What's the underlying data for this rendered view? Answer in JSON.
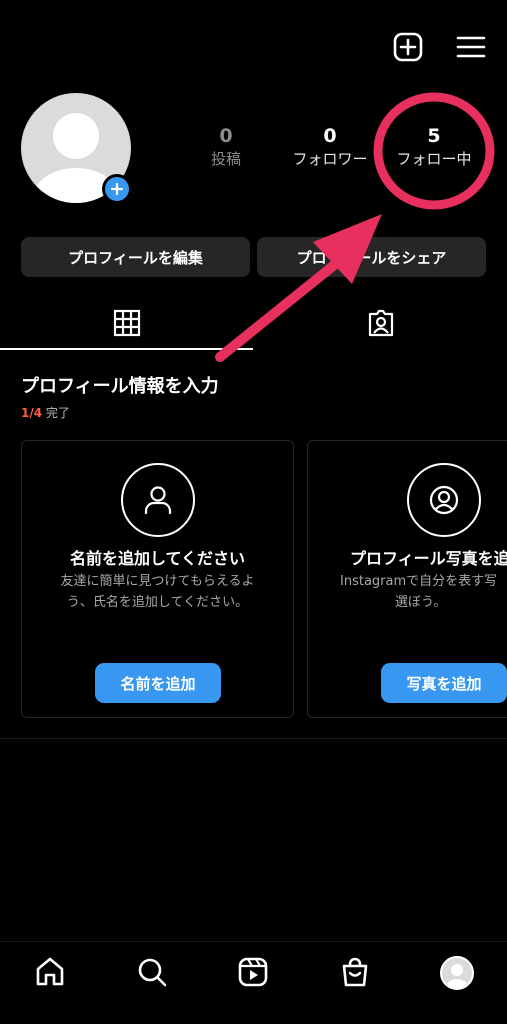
{
  "header": {
    "icons": [
      "plus-square-icon",
      "hamburger-menu-icon"
    ]
  },
  "stats": {
    "posts": {
      "count": "0",
      "label": "投稿"
    },
    "followers": {
      "count": "0",
      "label": "フォロワー"
    },
    "following": {
      "count": "5",
      "label": "フォロー中"
    }
  },
  "buttons": {
    "edit_profile": "プロフィールを編集",
    "share_profile": "プロフィールをシェア"
  },
  "tabs": {
    "grid": "grid-icon",
    "tagged": "tagged-person-icon"
  },
  "section": {
    "title": "プロフィール情報を入力",
    "progress_done": "1/4",
    "progress_label": " 完了"
  },
  "cards": [
    {
      "icon": "person-icon",
      "title": "名前を追加してください",
      "desc_line1": "友達に簡単に見つけてもらえるよ",
      "desc_line2": "う、氏名を追加してください。",
      "button": "名前を追加"
    },
    {
      "icon": "person-circle-icon",
      "title": "プロフィール写真を追",
      "desc_line1": "Instagramで自分を表す写",
      "desc_line2": "選ぼう。",
      "button": "写真を追加"
    }
  ],
  "bottom_nav": [
    "home-icon",
    "search-icon",
    "reels-icon",
    "shop-icon",
    "profile-avatar"
  ],
  "colors": {
    "background": "#000000",
    "accent_blue": "#3897f0",
    "highlight_pink": "#e8305f",
    "progress_orange": "#f56040",
    "button_gray": "#262626"
  }
}
